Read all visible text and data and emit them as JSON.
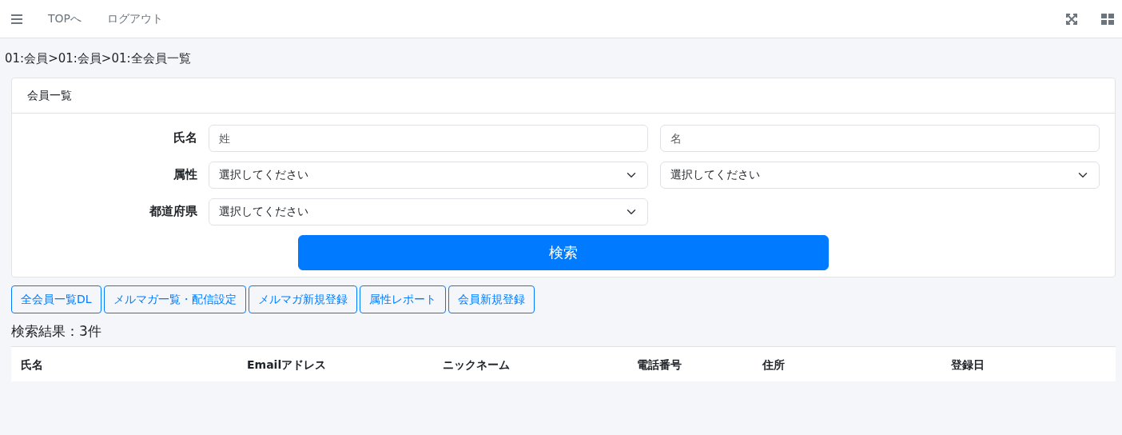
{
  "navbar": {
    "links": [
      "TOPへ",
      "ログアウト"
    ]
  },
  "breadcrumb": "01:会員>01:会員>01:全会員一覧",
  "card": {
    "title": "会員一覧",
    "form_rows": [
      {
        "label": "氏名",
        "controls": [
          {
            "kind": "input",
            "placeholder": "姓"
          },
          {
            "kind": "input",
            "placeholder": "名"
          }
        ]
      },
      {
        "label": "属性",
        "controls": [
          {
            "kind": "select",
            "value": "選択してください"
          },
          {
            "kind": "select",
            "value": "選択してください"
          }
        ]
      },
      {
        "label": "都道府県",
        "controls": [
          {
            "kind": "select",
            "value": "選択してください"
          }
        ]
      }
    ],
    "search_button": "検索"
  },
  "action_buttons": [
    "全会員一覧DL",
    "メルマガ一覧・配信設定",
    "メルマガ新規登録",
    "属性レポート",
    "会員新規登録"
  ],
  "result_count": "検索結果：3件",
  "table": {
    "columns": [
      "氏名",
      "Emailアドレス",
      "ニックネーム",
      "電話番号",
      "住所",
      "登録日"
    ]
  }
}
